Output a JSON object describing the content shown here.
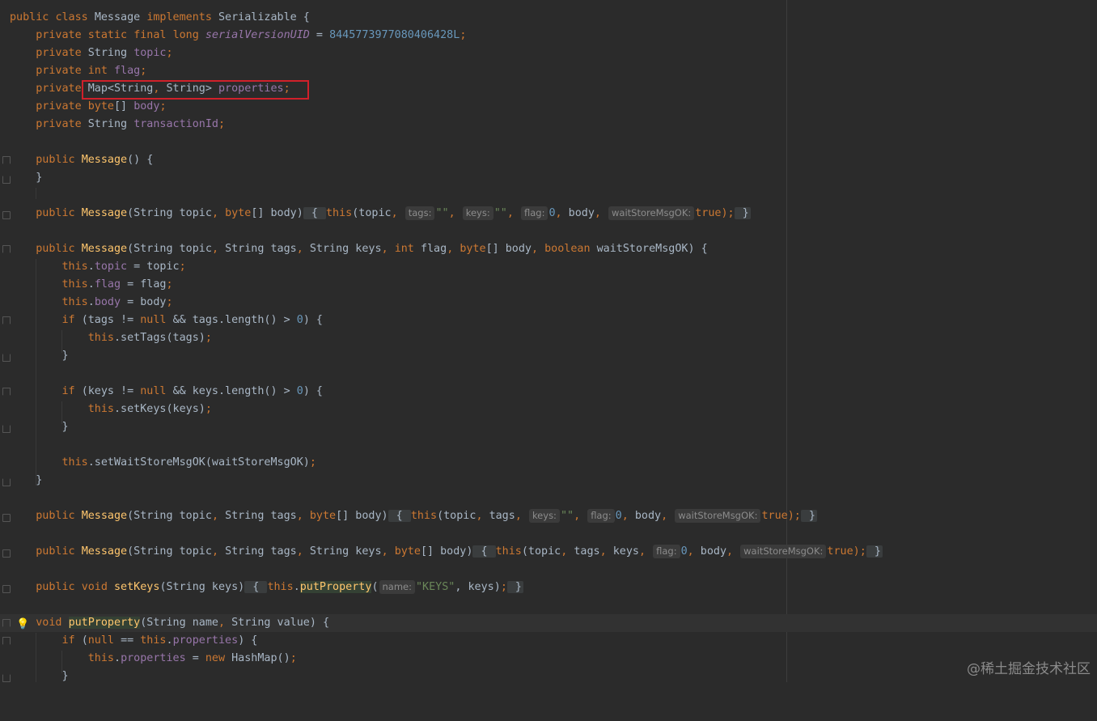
{
  "editor": {
    "watermark": "@稀土掘金技术社区"
  },
  "code": {
    "class_decl": [
      "public ",
      "class ",
      "Message ",
      "implements ",
      "Serializable {"
    ],
    "l2": [
      "private ",
      "static ",
      "final ",
      "long ",
      "serialVersionUID",
      " = ",
      "8445773977080406428L",
      ";"
    ],
    "l3": [
      "private ",
      "String ",
      "topic",
      ";"
    ],
    "l4": [
      "private ",
      "int ",
      "flag",
      ";"
    ],
    "l5": [
      "private ",
      "Map<String",
      ", ",
      "String> ",
      "properties",
      ";"
    ],
    "l6": [
      "private ",
      "byte",
      "[] ",
      "body",
      ";"
    ],
    "l7": [
      "private ",
      "String ",
      "transactionId",
      ";"
    ],
    "l9": [
      "public ",
      "Message",
      "() {"
    ],
    "l10": [
      "}"
    ],
    "l12": [
      "public ",
      "Message",
      "(String topic",
      ", ",
      "byte",
      "[] body)",
      " { ",
      "this",
      "(topic",
      ", ",
      "tags:",
      "\"\"",
      ", ",
      "keys:",
      "\"\"",
      ", ",
      "flag:",
      "0",
      ", ",
      "body",
      ", ",
      "waitStoreMsgOK:",
      "true",
      ");",
      " }"
    ],
    "l14": [
      "public ",
      "Message",
      "(String topic",
      ", ",
      "String tags",
      ", ",
      "String keys",
      ", ",
      "int ",
      "flag",
      ", ",
      "byte",
      "[] body",
      ", ",
      "boolean ",
      "waitStoreMsgOK) {"
    ],
    "l15": [
      "this",
      ".",
      "topic",
      " = topic",
      ";"
    ],
    "l16": [
      "this",
      ".",
      "flag",
      " = flag",
      ";"
    ],
    "l17": [
      "this",
      ".",
      "body",
      " = body",
      ";"
    ],
    "l18": [
      "if ",
      "(tags != ",
      "null ",
      "&& tags.length() > ",
      "0",
      ") {"
    ],
    "l19": [
      "this",
      ".setTags(tags)",
      ";"
    ],
    "l20": [
      "}"
    ],
    "l22": [
      "if ",
      "(keys != ",
      "null ",
      "&& keys.length() > ",
      "0",
      ") {"
    ],
    "l23": [
      "this",
      ".setKeys(keys)",
      ";"
    ],
    "l24": [
      "}"
    ],
    "l26": [
      "this",
      ".setWaitStoreMsgOK(waitStoreMsgOK)",
      ";"
    ],
    "l27": [
      "}"
    ],
    "l29": [
      "public ",
      "Message",
      "(String topic",
      ", ",
      "String tags",
      ", ",
      "byte",
      "[] body)",
      " { ",
      "this",
      "(topic",
      ", ",
      "tags",
      ", ",
      "keys:",
      "\"\"",
      ", ",
      "flag:",
      "0",
      ", ",
      "body",
      ", ",
      "waitStoreMsgOK:",
      "true",
      ");",
      " }"
    ],
    "l31": [
      "public ",
      "Message",
      "(String topic",
      ", ",
      "String tags",
      ", ",
      "String keys",
      ", ",
      "byte",
      "[] body)",
      " { ",
      "this",
      "(topic",
      ", ",
      "tags",
      ", ",
      "keys",
      ", ",
      "flag:",
      "0",
      ", ",
      "body",
      ", ",
      "waitStoreMsgOK:",
      "true",
      ");",
      " }"
    ],
    "l33": [
      "public ",
      "void ",
      "setKeys",
      "(String keys)",
      " { ",
      "this",
      ".",
      "putProperty",
      "(",
      "name:",
      "\"KEYS\"",
      ", keys)",
      ";",
      " }"
    ],
    "l35": [
      "void ",
      "putProperty",
      "(String name",
      ", ",
      "String value) {"
    ],
    "l36": [
      "if ",
      "(",
      "null ",
      "== ",
      "this",
      ".",
      "properties",
      ") {"
    ],
    "l37": [
      "this",
      ".",
      "properties",
      " = ",
      "new ",
      "HashMap()",
      ";"
    ],
    "l38": [
      "}"
    ]
  }
}
